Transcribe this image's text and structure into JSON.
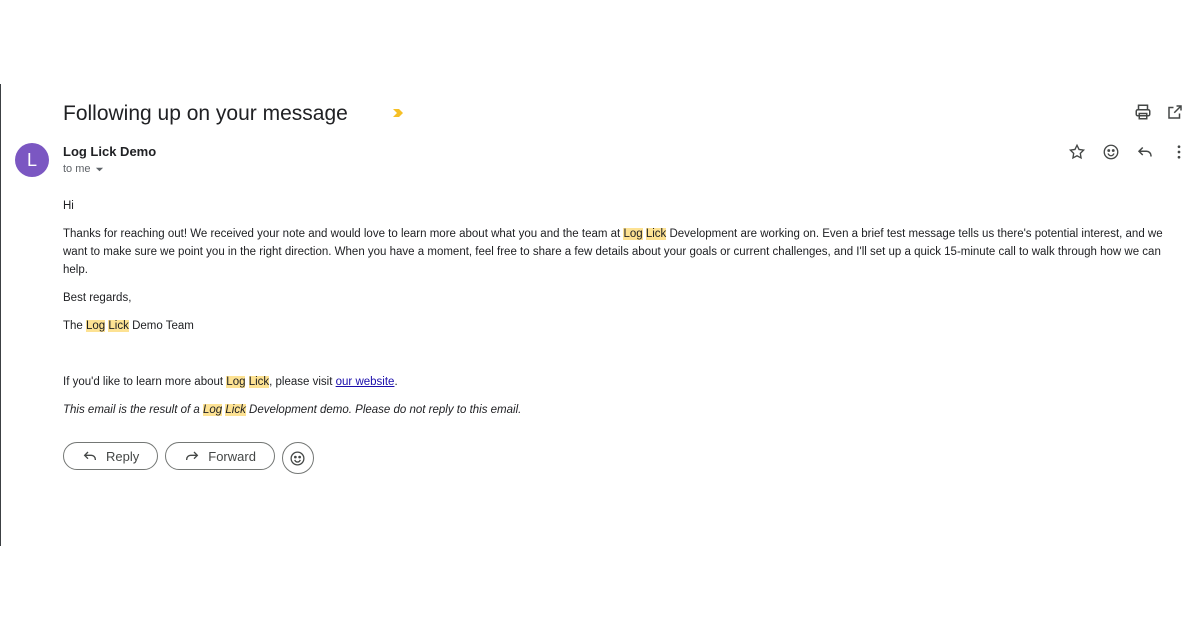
{
  "email": {
    "subject": "Following up on your message",
    "sender_initial": "L",
    "sender_name": "Log Lick Demo",
    "recipient": "to me",
    "body": {
      "greeting": "Hi",
      "p1_a": "Thanks for reaching out! We received your note and would love to learn more about what you and the team at ",
      "p1_b": "Development are working on. Even a brief test message tells us there's potential interest, and we want to make sure we point you in the right direction. When you have a moment, feel free to share a few details about your goals or current challenges, and I'll set up a quick 15-minute call to walk through how we can help.",
      "closing": "Best regards,",
      "sig_a": "The ",
      "sig_b": "Demo Team",
      "more_a": "If you'd like to learn more about ",
      "more_b": ", please visit ",
      "more_link": "our website",
      "more_c": ".",
      "note_a": "This email is the result of a ",
      "note_b": "Development demo. Please do not reply to this email.",
      "hl_log": "Log",
      "hl_lick": "Lick"
    }
  },
  "actions": {
    "reply_label": "Reply",
    "forward_label": "Forward"
  },
  "colors": {
    "avatar": "#7b57c2",
    "highlight": "#fde293",
    "importance": "#f6c026",
    "link": "#1a0dab"
  }
}
